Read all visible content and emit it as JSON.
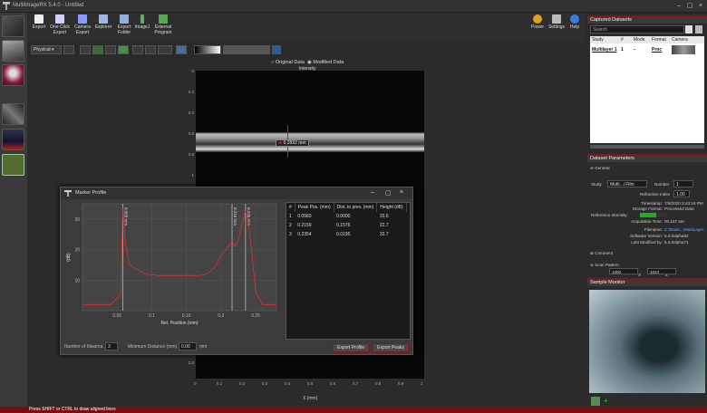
{
  "window": {
    "title": "MultiImageRX 5.4.0 - Untitled"
  },
  "toolbar": {
    "items": [
      {
        "label": "Export"
      },
      {
        "label": "One Click Export"
      },
      {
        "label": "Camera Export"
      },
      {
        "label": "Explorer"
      },
      {
        "label": "Export Folder"
      },
      {
        "label": "ImageJ"
      },
      {
        "label": "External Program"
      }
    ],
    "right_items": [
      {
        "label": "Power"
      },
      {
        "label": "Settings"
      },
      {
        "label": "Help"
      }
    ]
  },
  "subtoolbar": {
    "mode_select": "Physical"
  },
  "view": {
    "radio_original": "Original Data",
    "radio_modified": "Modified Data",
    "intensity_label": "Intensity",
    "marker_value": "0.2892 mm",
    "x_axis_title": "X (mm)",
    "y_ticks": [
      "0",
      "0.2",
      "0.4",
      "0.6",
      "0.8",
      "1",
      "1.2",
      "1.4",
      "1.6",
      "1.8",
      "2",
      "2.2",
      "2.4",
      "2.6",
      "2.8"
    ],
    "x_ticks": [
      "0",
      "0.1",
      "0.2",
      "0.3",
      "0.4",
      "0.5",
      "0.6",
      "0.7",
      "0.8",
      "0.9",
      "1"
    ]
  },
  "modal": {
    "title": "Marker Profile",
    "columns": [
      "#",
      "Peak Pos. (mm)",
      "Dist. to prev. (mm)",
      "Height (dB)"
    ],
    "rows": [
      [
        "1",
        "0.0583",
        "0.0000",
        "33.6"
      ],
      [
        "2",
        "0.2159",
        "0.1576",
        "22.7"
      ],
      [
        "3",
        "0.2354",
        "0.0195",
        "32.7"
      ]
    ],
    "num_maxima_label": "Number of Maxima",
    "num_maxima_value": "3",
    "min_distance_label": "Minimum Distance (mm)",
    "min_distance_value": "0.00",
    "min_distance_unit": "mm",
    "export_profile": "Export Profile",
    "export_peaks": "Export Peaks"
  },
  "right": {
    "captured_title": "Captured Datasets",
    "search_placeholder": "Search",
    "columns": [
      "Study",
      "#",
      "Mode",
      "Format",
      "Camera"
    ],
    "dataset_row": {
      "study": "Multilayer 1",
      "num": "1",
      "format": "Proc"
    },
    "params_title": "Dataset Parameters",
    "general": "General",
    "study_label": "Study",
    "study_value": "Multi...i Film",
    "number_label": "Number",
    "number_value": "1",
    "refractive_label": "Refractive Index",
    "refractive_value": "1.00",
    "timestamp_label": "Timestamp:",
    "timestamp_value": "7/9/2020 3:43:16 PM",
    "storage_label": "Storage Format:",
    "storage_value": "Processed Data",
    "ref_int_label": "Reference Intensity:",
    "acq_label": "Acquisition Time:",
    "acq_value": "00.167 sec",
    "filename_label": "Filename:",
    "filename_value": "C:\\Data\\...\\MultiLayer...",
    "sw_label": "Software Version:",
    "sw_value": "5.4.0alpha62",
    "lastmod_label": "Last Modified by:",
    "lastmod_value": "5.4.0alpha71",
    "comment": "Comment",
    "scan": "Scan Pattern",
    "scan_x": "X",
    "scan_z": "Z",
    "scan_v1": "1000",
    "scan_v2": "1024",
    "sample_title": "Sample Monitor"
  },
  "status": {
    "text": "Press SHIFT or CTRL to draw aligned lines"
  },
  "chart_data": {
    "type": "line",
    "title": "",
    "xlabel": "Rel. Position (mm)",
    "ylabel": "(dB)",
    "xlim": [
      0,
      0.28
    ],
    "ylim": [
      0,
      35
    ],
    "x_ticks": [
      "0.05",
      "0.1",
      "0.15",
      "0.2",
      "0.25"
    ],
    "y_ticks": [
      "10",
      "20",
      "30"
    ],
    "markers": [
      {
        "x": 0.0583,
        "label": "0.058 mm"
      },
      {
        "x": 0.2159,
        "label": "0.216 mm"
      },
      {
        "x": 0.2354,
        "label": "0.235 mm"
      }
    ],
    "series": [
      {
        "x": [
          0,
          0.04,
          0.055,
          0.0583,
          0.062,
          0.068,
          0.075,
          0.09,
          0.11,
          0.13,
          0.15,
          0.17,
          0.18,
          0.19,
          0.2,
          0.21,
          0.2159,
          0.22,
          0.225,
          0.23,
          0.2354,
          0.24,
          0.245,
          0.25,
          0.26,
          0.28
        ],
        "values": [
          2,
          2,
          5,
          33.6,
          22,
          15,
          14,
          12,
          11.5,
          11.5,
          11.5,
          11.5,
          12,
          14,
          18,
          21,
          22.7,
          21,
          23,
          28,
          32.7,
          28,
          18,
          6,
          2,
          2
        ]
      }
    ]
  }
}
